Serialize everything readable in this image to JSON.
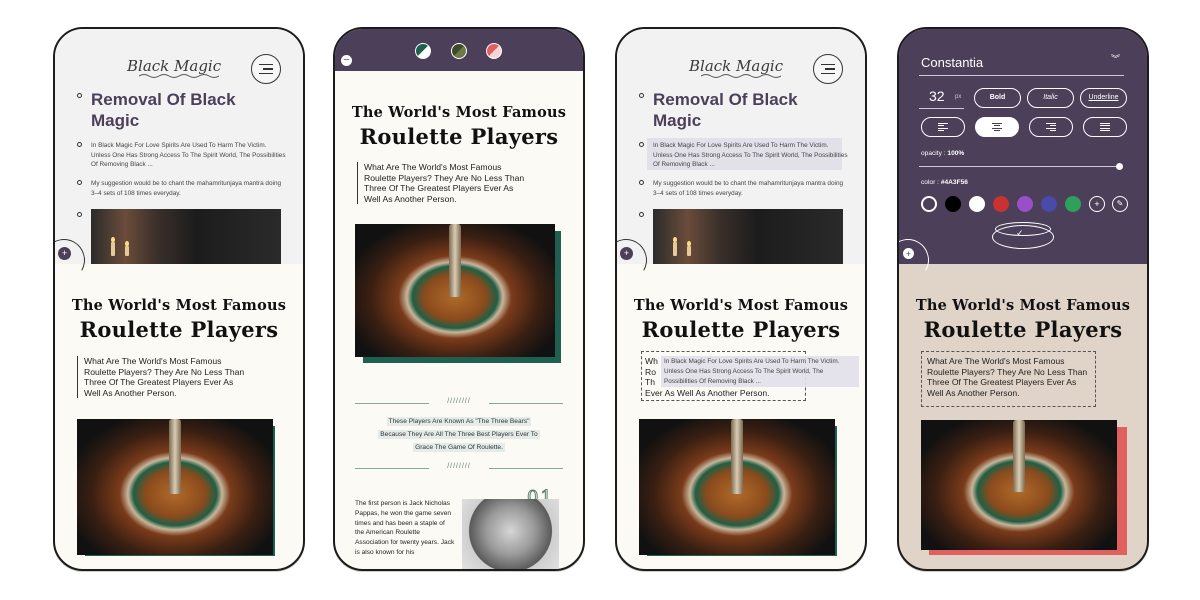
{
  "logo": "Black Magic",
  "removal_title": "Removal Of Black Magic",
  "removal_para1": "In Black Magic For Love Spirits Are Used To Harm The Victim. Unless One Has Strong Access To The Spirit World, The Possibilities Of Removing Black ...",
  "removal_para2": "My suggestion would be to chant the mahamritunjaya mantra doing 3–4 sets of 108 times everyday.",
  "famous_line1": "The World's Most Famous",
  "famous_line2": "Roulette Players",
  "famous_quote": "What Are The World's Most Famous Roulette Players? They Are No Less Than Three Of The Greatest Players Ever As Well As Another Person.",
  "quote_last_line": "Ever As Well As Another Person.",
  "quote_partial": "Wh\nRo\nTh",
  "slashes": "////////",
  "bears_line1": "These Players Are Known As \"The Three Bears\"",
  "bears_line2": "Because They Are All The Three Best Players Ever To",
  "bears_line3": "Grace The Game Of Roulette.",
  "jack_para": "The first person is Jack Nicholas Pappas, he won the game seven times and has been a staple of the American Roulette Association for twenty years. Jack is also known for his",
  "number_label": "01",
  "editor": {
    "font_name": "Constantia",
    "font_size": "32",
    "font_unit": "px",
    "bold_label": "Bold",
    "italic_label": "Italic",
    "underline_label": "Underline",
    "opacity_label": "opacity :",
    "opacity_value": "100%",
    "color_label": "color :",
    "color_value": "#4A3F56",
    "plus_label": "+",
    "swatches": [
      "#4b3f5a",
      "#000000",
      "#ffffff",
      "#c83232",
      "#9a4fc8",
      "#4a4aa8",
      "#2fa05a"
    ]
  },
  "colors": {
    "purple": "#4b3f5a",
    "green_accent": "#1f5f4f",
    "red_accent": "#e06060",
    "beige": "#e0d3c8"
  }
}
